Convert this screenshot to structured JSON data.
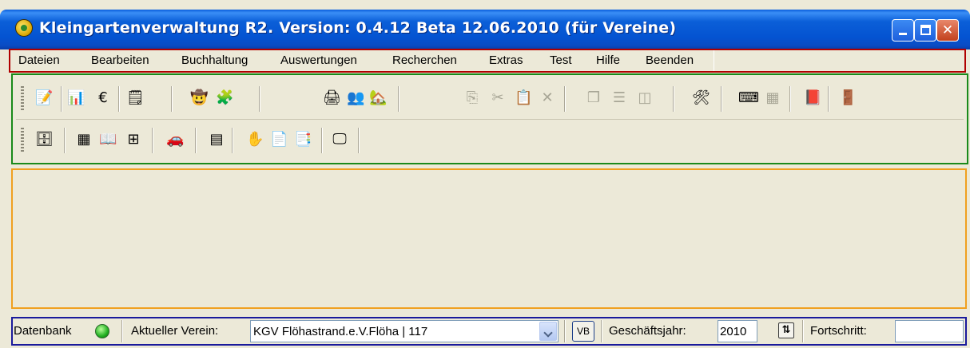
{
  "window": {
    "title": "Kleingartenverwaltung R2. Version: 0.4.12 Beta 12.06.2010 (für Vereine)",
    "controls": {
      "minimize": "minimize",
      "maximize": "maximize",
      "close": "✕"
    }
  },
  "menu": {
    "items": [
      "Dateien",
      "Bearbeiten",
      "Buchhaltung",
      "Auswertungen",
      "Recherchen",
      "Extras",
      "Test",
      "Hilfe",
      "Beenden"
    ]
  },
  "toolbar": {
    "row1": [
      {
        "name": "edit-icon",
        "glyph": "📝",
        "enabled": true
      },
      {
        "name": "chart-icon",
        "glyph": "📊",
        "enabled": true
      },
      {
        "name": "euro-icon",
        "glyph": "€",
        "enabled": true
      },
      {
        "name": "properties-icon",
        "glyph": "🗒",
        "enabled": true
      },
      {
        "name": "person-icon",
        "glyph": "🤠",
        "enabled": true
      },
      {
        "name": "puzzle-icon",
        "glyph": "🧩",
        "enabled": true
      },
      {
        "name": "printer-icon",
        "glyph": "🖨",
        "enabled": true
      },
      {
        "name": "people-icon",
        "glyph": "👥",
        "enabled": true
      },
      {
        "name": "garden-icon",
        "glyph": "🏡",
        "enabled": true
      },
      {
        "name": "copy-icon",
        "glyph": "⎘",
        "enabled": false
      },
      {
        "name": "cut-icon",
        "glyph": "✂",
        "enabled": false
      },
      {
        "name": "paste-icon",
        "glyph": "📋",
        "enabled": false
      },
      {
        "name": "delete-icon",
        "glyph": "✕",
        "enabled": false
      },
      {
        "name": "stack-windows-icon",
        "glyph": "❐",
        "enabled": false
      },
      {
        "name": "tile-horizontal-icon",
        "glyph": "☰",
        "enabled": false
      },
      {
        "name": "tile-vertical-icon",
        "glyph": "◫",
        "enabled": false
      },
      {
        "name": "tools-icon",
        "glyph": "🛠",
        "enabled": true
      },
      {
        "name": "keyboard-icon",
        "glyph": "⌨",
        "enabled": true
      },
      {
        "name": "calendar-icon",
        "glyph": "▦",
        "enabled": false
      },
      {
        "name": "book-icon",
        "glyph": "📕",
        "enabled": true
      },
      {
        "name": "exit-icon",
        "glyph": "🚪",
        "enabled": true
      }
    ],
    "row2": [
      {
        "name": "cabinet-icon",
        "glyph": "🗄",
        "enabled": true
      },
      {
        "name": "table-icon",
        "glyph": "▦",
        "enabled": true
      },
      {
        "name": "open-book-icon",
        "glyph": "📖",
        "enabled": true
      },
      {
        "name": "tree-list-icon",
        "glyph": "⊞",
        "enabled": true
      },
      {
        "name": "car-icon",
        "glyph": "🚗",
        "enabled": true
      },
      {
        "name": "list-icon",
        "glyph": "▤",
        "enabled": true
      },
      {
        "name": "hand-icon",
        "glyph": "✋",
        "enabled": true
      },
      {
        "name": "document-arrow-icon",
        "glyph": "📄",
        "enabled": true
      },
      {
        "name": "report-icon",
        "glyph": "📑",
        "enabled": true
      },
      {
        "name": "screen-icon",
        "glyph": "🖵",
        "enabled": true
      }
    ]
  },
  "status": {
    "db_label": "Datenbank",
    "club_label": "Aktueller Verein:",
    "club_value": "KGV Flöhastrand.e.V.Flöha | 117",
    "vb_label": "VB",
    "year_label": "Geschäftsjahr:",
    "year_value": "2010",
    "year_button": "⇅",
    "progress_label": "Fortschritt:",
    "db_status_color": "#22b022"
  },
  "colors": {
    "titlebar": "#0453d1",
    "menu_border": "#b00000",
    "toolbar_border": "#1a8a1a",
    "content_border": "#f0a020",
    "status_border": "#1a1a9c"
  }
}
